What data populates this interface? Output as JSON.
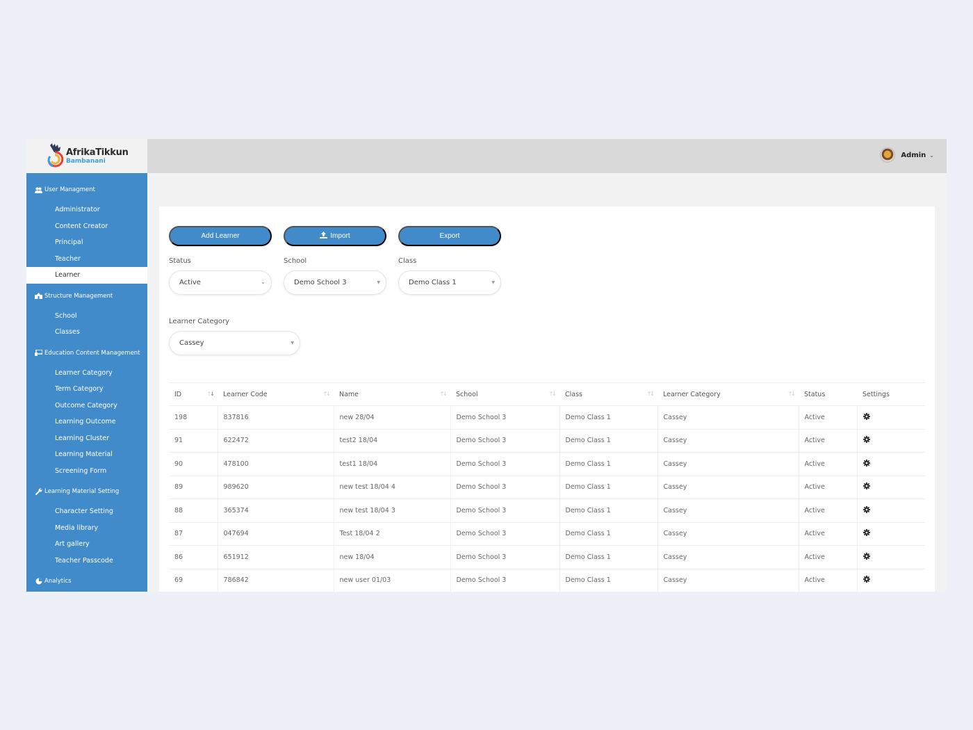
{
  "brand": {
    "title": "AfrikaTikkun",
    "subtitle": "Bambanani",
    "colors": {
      "primary": "#428bcb",
      "active_status": "#5ac98a",
      "header_bg": "#d9d9d9"
    }
  },
  "header": {
    "user_name": "Admin",
    "caret_icon": "chevron-down-icon"
  },
  "sidebar": {
    "sections": [
      {
        "label": "User Managment",
        "icon": "users-icon",
        "items": [
          {
            "label": "Administrator",
            "active": false
          },
          {
            "label": "Content Creator",
            "active": false
          },
          {
            "label": "Principal",
            "active": false
          },
          {
            "label": "Teacher",
            "active": false
          },
          {
            "label": "Learner",
            "active": true
          }
        ]
      },
      {
        "label": "Structure Management",
        "icon": "building-icon",
        "items": [
          {
            "label": "School",
            "active": false
          },
          {
            "label": "Classes",
            "active": false
          }
        ]
      },
      {
        "label": "Education Content Management",
        "icon": "chalkboard-icon",
        "items": [
          {
            "label": "Learner Category",
            "active": false
          },
          {
            "label": "Term Category",
            "active": false
          },
          {
            "label": "Outcome Category",
            "active": false
          },
          {
            "label": "Learning Outcome",
            "active": false
          },
          {
            "label": "Learning Cluster",
            "active": false
          },
          {
            "label": "Learning Material",
            "active": false
          },
          {
            "label": "Screening Form",
            "active": false
          }
        ]
      },
      {
        "label": "Learning Material Setting",
        "icon": "wrench-icon",
        "items": [
          {
            "label": "Character Setting",
            "active": false
          },
          {
            "label": "Media library",
            "active": false
          },
          {
            "label": "Art gallery",
            "active": false
          },
          {
            "label": "Teacher Passcode",
            "active": false
          }
        ]
      },
      {
        "label": "Analytics",
        "icon": "pie-chart-icon",
        "items": []
      }
    ]
  },
  "toolbar": {
    "add_label": "Add Learner",
    "import_label": "Import",
    "import_icon": "upload-icon",
    "export_label": "Export"
  },
  "filters": {
    "status": {
      "label": "Status",
      "value": "Active"
    },
    "school": {
      "label": "School",
      "value": "Demo School 3"
    },
    "class": {
      "label": "Class",
      "value": "Demo Class 1"
    },
    "category": {
      "label": "Learner Category",
      "value": "Cassey"
    }
  },
  "table": {
    "columns": [
      "ID",
      "Learner Code",
      "Name",
      "School",
      "Class",
      "Learner Category",
      "Status",
      "Settings"
    ],
    "rows": [
      {
        "id": "198",
        "code": "837816",
        "name": "new 28/04",
        "school": "Demo School 3",
        "class": "Demo Class 1",
        "category": "Cassey",
        "status": "Active"
      },
      {
        "id": "91",
        "code": "622472",
        "name": "test2 18/04",
        "school": "Demo School 3",
        "class": "Demo Class 1",
        "category": "Cassey",
        "status": "Active"
      },
      {
        "id": "90",
        "code": "478100",
        "name": "test1 18/04",
        "school": "Demo School 3",
        "class": "Demo Class 1",
        "category": "Cassey",
        "status": "Active"
      },
      {
        "id": "89",
        "code": "989620",
        "name": "new test 18/04 4",
        "school": "Demo School 3",
        "class": "Demo Class 1",
        "category": "Cassey",
        "status": "Active"
      },
      {
        "id": "88",
        "code": "365374",
        "name": "new test 18/04 3",
        "school": "Demo School 3",
        "class": "Demo Class 1",
        "category": "Cassey",
        "status": "Active"
      },
      {
        "id": "87",
        "code": "047694",
        "name": "Test 18/04 2",
        "school": "Demo School 3",
        "class": "Demo Class 1",
        "category": "Cassey",
        "status": "Active"
      },
      {
        "id": "86",
        "code": "651912",
        "name": "new 18/04",
        "school": "Demo School 3",
        "class": "Demo Class 1",
        "category": "Cassey",
        "status": "Active"
      },
      {
        "id": "69",
        "code": "786842",
        "name": "new user 01/03",
        "school": "Demo School 3",
        "class": "Demo Class 1",
        "category": "Cassey",
        "status": "Active"
      }
    ]
  }
}
